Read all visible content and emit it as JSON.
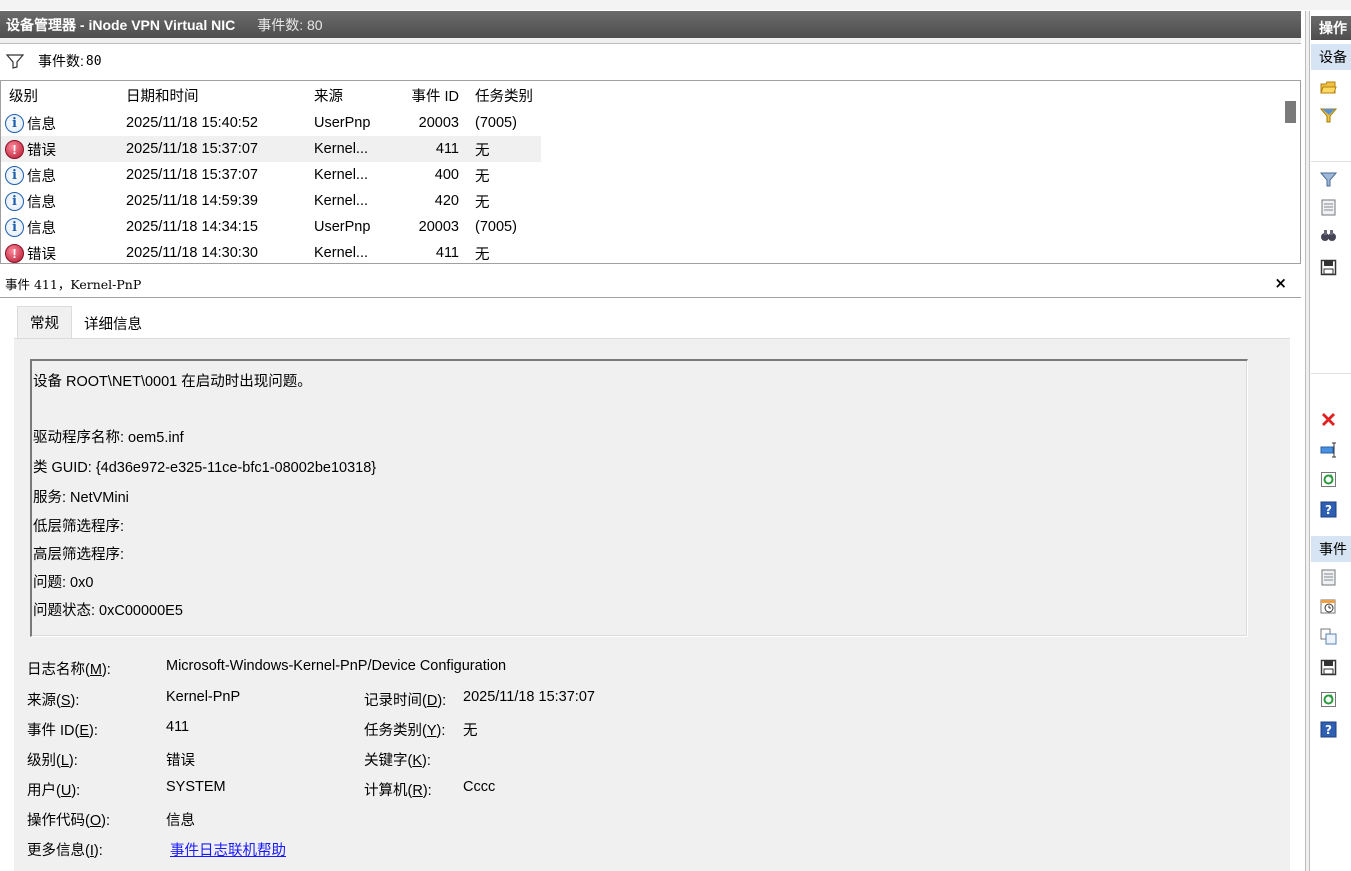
{
  "window": {
    "title": "设备管理器 - iNode VPN Virtual NIC",
    "event_count_label": "事件数: 80"
  },
  "filter": {
    "label": "事件数",
    "value": "80"
  },
  "grid": {
    "columns": [
      "级别",
      "日期和时间",
      "来源",
      "事件 ID",
      "任务类别"
    ],
    "rows": [
      {
        "level": "信息",
        "level_icon": "info-icon",
        "datetime": "2025/11/18 15:40:52",
        "source": "UserPnp",
        "event_id": "20003",
        "task": "(7005)"
      },
      {
        "level": "错误",
        "level_icon": "error-icon",
        "datetime": "2025/11/18 15:37:07",
        "source": "Kernel...",
        "event_id": "411",
        "task": "无",
        "selected": true
      },
      {
        "level": "信息",
        "level_icon": "info-icon",
        "datetime": "2025/11/18 15:37:07",
        "source": "Kernel...",
        "event_id": "400",
        "task": "无"
      },
      {
        "level": "信息",
        "level_icon": "info-icon",
        "datetime": "2025/11/18 14:59:39",
        "source": "Kernel...",
        "event_id": "420",
        "task": "无"
      },
      {
        "level": "信息",
        "level_icon": "info-icon",
        "datetime": "2025/11/18 14:34:15",
        "source": "UserPnp",
        "event_id": "20003",
        "task": "(7005)"
      },
      {
        "level": "错误",
        "level_icon": "error-icon",
        "datetime": "2025/11/18 14:30:30",
        "source": "Kernel...",
        "event_id": "411",
        "task": "无"
      }
    ]
  },
  "detail": {
    "header": "事件 411，Kernel-PnP",
    "close": "×",
    "tabs": [
      "常规",
      "详细信息"
    ],
    "description": [
      "设备 ROOT\\NET\\0001 在启动时出现问题。",
      "驱动程序名称: oem5.inf",
      "类 GUID: {4d36e972-e325-11ce-bfc1-08002be10318}",
      "服务: NetVMini",
      "低层筛选程序:",
      "高层筛选程序:",
      "问题: 0x0",
      "问题状态: 0xC00000E5"
    ],
    "fields": {
      "log_name": {
        "label": "日志名称(",
        "key": "M",
        "end": "):",
        "value": "Microsoft-Windows-Kernel-PnP/Device Configuration"
      },
      "source": {
        "label": "来源(",
        "key": "S",
        "end": "):",
        "value": "Kernel-PnP"
      },
      "logged": {
        "label": "记录时间(",
        "key": "D",
        "end": "):",
        "value": "2025/11/18 15:37:07"
      },
      "event_id": {
        "label": "事件 ID(",
        "key": "E",
        "end": "):",
        "value": "411"
      },
      "task": {
        "label": "任务类别(",
        "key": "Y",
        "end": "):",
        "value": "无"
      },
      "level": {
        "label": "级别(",
        "key": "L",
        "end": "):",
        "value": "错误"
      },
      "keywords": {
        "label": "关键字(",
        "key": "K",
        "end": "):",
        "value": ""
      },
      "user": {
        "label": "用户(",
        "key": "U",
        "end": "):",
        "value": "SYSTEM"
      },
      "computer": {
        "label": "计算机(",
        "key": "R",
        "end": "):",
        "value": "Cccc"
      },
      "opcode": {
        "label": "操作代码(",
        "key": "O",
        "end": "):",
        "value": "信息"
      },
      "more_info": {
        "label": "更多信息(",
        "key": "I",
        "end": "):",
        "value": "事件日志联机帮助"
      }
    }
  },
  "actions": {
    "title": "操作",
    "section1": "设备",
    "section2": "事件",
    "icons": [
      "open-folder-icon",
      "filter-icon",
      "filter-clear-icon",
      "properties-icon",
      "find-icon",
      "save-icon",
      "delete-icon",
      "rename-icon",
      "refresh-icon",
      "help-icon",
      "event-properties-icon",
      "attach-task-icon",
      "copy-icon",
      "save-event-icon",
      "refresh-event-icon",
      "help-event-icon"
    ]
  }
}
